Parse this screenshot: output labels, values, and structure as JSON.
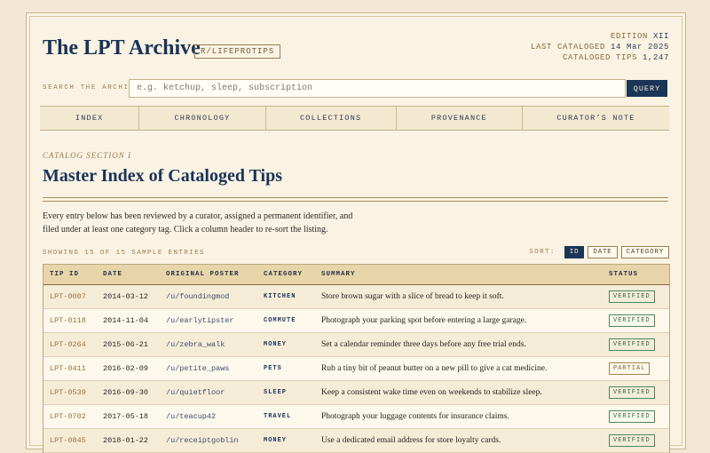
{
  "header": {
    "title": "The LPT Archive",
    "subreddit": "R/LIFEPROTIPS",
    "edition_label": "EDITION",
    "edition_value": "XII",
    "last_cataloged_label": "LAST CATALOGED",
    "last_cataloged_value": "14 Mar 2025",
    "cataloged_tips_label": "CATALOGED TIPS",
    "cataloged_tips_value": "1,247"
  },
  "search": {
    "label": "SEARCH THE ARCHIVE",
    "placeholder": "e.g. ketchup, sleep, subscription",
    "button": "QUERY"
  },
  "nav": {
    "items": [
      "INDEX",
      "CHRONOLOGY",
      "COLLECTIONS",
      "PROVENANCE",
      "CURATOR’S NOTE"
    ]
  },
  "section": {
    "eyebrow": "CATALOG SECTION I",
    "title": "Master Index of Cataloged Tips",
    "intro": "Every entry below has been reviewed by a curator, assigned a permanent identifier, and filed under at least one category tag. Click a column header to re-sort the listing."
  },
  "listing": {
    "showing": "SHOWING 15 OF 15 SAMPLE ENTRIES",
    "sort_label": "SORT:",
    "sort_options": [
      "ID",
      "DATE",
      "CATEGORY"
    ],
    "sort_active": "ID"
  },
  "table": {
    "headers": [
      "TIP ID",
      "DATE",
      "ORIGINAL POSTER",
      "CATEGORY",
      "SUMMARY",
      "STATUS"
    ],
    "rows": [
      {
        "id": "LPT-0007",
        "date": "2014-03-12",
        "poster": "/u/foundingmod",
        "category": "KITCHEN",
        "summary": "Store brown sugar with a slice of bread to keep it soft.",
        "status": "VERIFIED"
      },
      {
        "id": "LPT-0118",
        "date": "2014-11-04",
        "poster": "/u/earlytipster",
        "category": "COMMUTE",
        "summary": "Photograph your parking spot before entering a large garage.",
        "status": "VERIFIED"
      },
      {
        "id": "LPT-0264",
        "date": "2015-06-21",
        "poster": "/u/zebra_walk",
        "category": "MONEY",
        "summary": "Set a calendar reminder three days before any free trial ends.",
        "status": "VERIFIED"
      },
      {
        "id": "LPT-0411",
        "date": "2016-02-09",
        "poster": "/u/petite_paws",
        "category": "PETS",
        "summary": "Rub a tiny bit of peanut butter on a new pill to give a cat medicine.",
        "status": "PARTIAL"
      },
      {
        "id": "LPT-0539",
        "date": "2016-09-30",
        "poster": "/u/quietfloor",
        "category": "SLEEP",
        "summary": "Keep a consistent wake time even on weekends to stabilize sleep.",
        "status": "VERIFIED"
      },
      {
        "id": "LPT-0702",
        "date": "2017-05-18",
        "poster": "/u/teacup42",
        "category": "TRAVEL",
        "summary": "Photograph your luggage contents for insurance claims.",
        "status": "VERIFIED"
      },
      {
        "id": "LPT-0845",
        "date": "2018-01-22",
        "poster": "/u/receiptgoblin",
        "category": "MONEY",
        "summary": "Use a dedicated email address for store loyalty cards.",
        "status": "VERIFIED"
      }
    ]
  }
}
